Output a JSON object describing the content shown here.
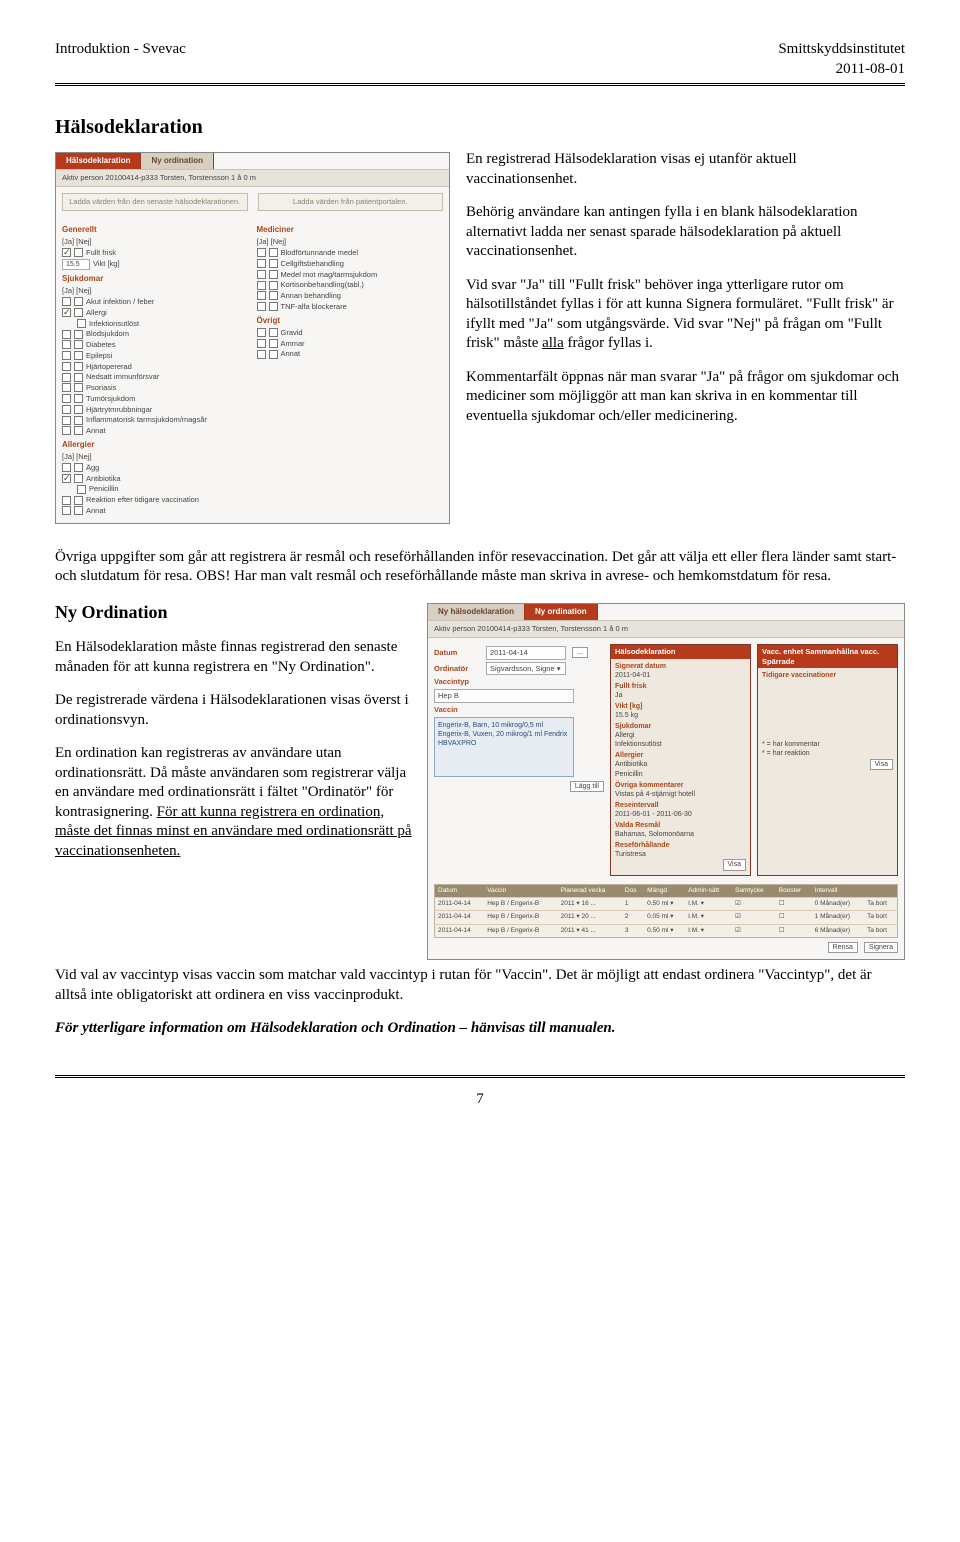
{
  "header": {
    "left": "Introduktion - Svevac",
    "right_top": "Smittskyddsinstitutet",
    "right_bottom": "2011-08-01"
  },
  "section1": {
    "title": "Hälsodeklaration",
    "p1": "En registrerad Hälsodeklaration visas ej utanför aktuell vaccinationsenhet.",
    "p2": "Behörig användare kan antingen fylla i en blank hälsodeklaration alternativt ladda ner senast sparade hälsodeklaration på aktuell vaccinationsenhet.",
    "p3a": "Vid svar \"Ja\" till \"Fullt frisk\" behöver inga ytterligare rutor om hälsotillståndet fyllas i för att kunna Signera formuläret. \"Fullt frisk\" är ifyllt med \"Ja\" som utgångsvärde. Vid svar \"Nej\" på frågan om \"Fullt frisk\" måste ",
    "p3_underline": "alla",
    "p3b": " frågor fyllas i.",
    "p4": "Kommentarfält öppnas när man svarar \"Ja\" på frågor om sjukdomar och mediciner som möjliggör att man kan skriva in en kommentar till eventuella sjukdomar och/eller medicinering.",
    "p5": "Övriga uppgifter som går att registrera är resmål och reseförhållanden inför resevaccination. Det går att välja ett eller flera länder samt start- och slutdatum för resa. OBS! Har man valt resmål och reseförhållande måste man skriva in avrese- och hemkomstdatum för resa."
  },
  "section2": {
    "title": "Ny Ordination",
    "p1": "En Hälsodeklaration måste finnas registrerad den senaste månaden för att kunna registrera en \"Ny Ordination\".",
    "p2": "De registrerade värdena i Hälsodeklarationen visas överst i ordinationsvyn.",
    "p3a": "En ordination kan registreras av användare utan ordinationsrätt. Då måste användaren som registrerar välja en användare med ordinationsrätt i fältet \"Ordinatör\" för kontrasignering. ",
    "p3_u1": "För att kunna registrera en ordination, måste det finnas minst en användare med ordinationsrätt på vaccinationsenheten.",
    "p4": "Vid val av vaccintyp visas vaccin som matchar vald vaccintyp i rutan för \"Vaccin\". Det är möjligt att endast ordinera \"Vaccintyp\", det är alltså inte obligatoriskt att ordinera en viss vaccinprodukt.",
    "p5": "För ytterligare information om Hälsodeklaration och Ordination – hänvisas till manualen."
  },
  "img1": {
    "tab_active": "Hälsodeklaration",
    "tab_inactive": "Ny ordination",
    "aktiv_person": "Aktiv person 20100414-p333  Torsten, Torstensson  1 å 0 m",
    "btn1": "Ladda värden från den senaste hälsodeklarationen.",
    "btn2": "Ladda värden från patientportalen.",
    "col1": {
      "h1": "Generellt",
      "janej": "[Ja]  [Nej]",
      "fullt_frisk": "Fullt frisk",
      "vikt": "Vikt [kg]",
      "vikt_val": "15.5",
      "h2": "Sjukdomar",
      "rows": [
        "Akut infektion / feber",
        "Allergi",
        "Infektionsutlöst",
        "Blodsjukdom",
        "Diabetes",
        "Epilepsi",
        "Hjärtopererad",
        "Nedsatt immunförsvar",
        "Psoriasis",
        "Tumörsjukdom",
        "Hjärtrytmrubbningar",
        "Inflammatorisk tarmsjukdom/magsår",
        "Annat"
      ],
      "h3": "Allergier",
      "arows": [
        "Ägg",
        "Antibiotika",
        "Penicillin",
        "Reaktion efter tidigare vaccination",
        "Annat"
      ]
    },
    "col2": {
      "h1": "Mediciner",
      "rows": [
        "Blodförtunnande medel",
        "Cellgiftsbehandling",
        "Medel mot mag/tarmsjukdom",
        "Kortisonbehandling(tabl.)",
        "Annan behandling",
        "TNF-alfa blockerare"
      ],
      "h2": "Övrigt",
      "orows": [
        "Gravid",
        "Ammar",
        "Annat"
      ]
    }
  },
  "img2": {
    "tab_inactive": "Ny hälsodeklaration",
    "tab_active": "Ny ordination",
    "aktiv_person": "Aktiv person 20100414-p333  Torsten, Torstensson  1 å 0 m",
    "lbl_datum": "Datum",
    "datum_val": "2011-04-14",
    "lbl_ord": "Ordinatör",
    "ord_val": "Sigvardsson, Signe ▾",
    "lbl_vt": "Vaccintyp",
    "vt_val": "Hep B",
    "lbl_vaccin": "Vaccin",
    "vaccin_box": "Engerix-B, Barn, 10 mikrog/0,5 ml\nEngerix-B, Vuxen, 20 mikrog/1 ml\nFendrix\nHBVAXPRO",
    "lagg": "Lägg till",
    "panel1": {
      "title": "Hälsodeklaration",
      "signerat": "Signerat datum",
      "signerat_v": "2011-04-01",
      "ff": "Fullt frisk",
      "ff_v": "Ja",
      "vikt": "Vikt [kg]",
      "vikt_v": "15.5 kg",
      "sjuk": "Sjukdomar",
      "sjuk_v": "Allergi\nInfektionsutlöst",
      "all": "Allergier",
      "all_v": "Antibiotika\nPenicillin",
      "ovr": "Övriga kommentarer",
      "ovr_v": "Vistas på 4-stjärnigt hotell",
      "res": "Reseintervall",
      "res_v": "2011-06-01 - 2011-06-30",
      "vm": "Valda Resmål",
      "vm_v": "Bahamas, Solomonöarna",
      "rf": "Reseförhållande",
      "rf_v": "Turistresa",
      "visa": "Visa"
    },
    "panel2_title": "Vacc. enhet    Sammanhållna vacc.    Spärrade",
    "panel2_h": "Tidigare vaccinationer",
    "panel2_legend": "* = har kommentar\n* = har reaktion",
    "table": {
      "cols": [
        "Datum",
        "Vaccin",
        "Planerad vecka",
        "Dos",
        "Mängd",
        "Admin-sätt",
        "Samtycke",
        "Booster",
        "Intervall",
        ""
      ],
      "rows": [
        [
          "2011-04-14",
          "Hep B / Engerix-B",
          "2011 ▾ 16  ...",
          "1",
          "0.50 ml ▾",
          "I.M. ▾",
          "☑",
          "☐",
          "0 Månad(er)",
          "Ta bort"
        ],
        [
          "2011-04-14",
          "Hep B / Engerix-B",
          "2011 ▾ 20  ...",
          "2",
          "0.05 ml ▾",
          "I.M. ▾",
          "☑",
          "☐",
          "1 Månad(er)",
          "Ta bort"
        ],
        [
          "2011-04-14",
          "Hep B / Engerix-B",
          "2011 ▾ 41  ...",
          "3",
          "0.50 ml ▾",
          "I.M. ▾",
          "☑",
          "☐",
          "6 Månad(er)",
          "Ta bort"
        ]
      ]
    },
    "rensa": "Rensa",
    "signera": "Signera"
  },
  "page_number": "7"
}
